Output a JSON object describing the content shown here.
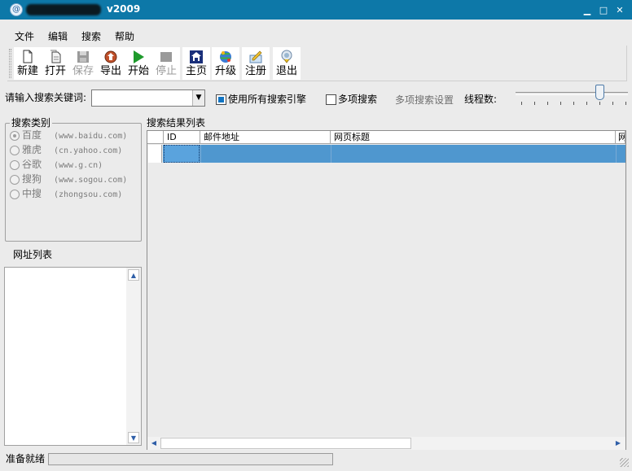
{
  "window": {
    "title_version": "v2009",
    "controls": {
      "minimize": "▁",
      "maximize": "□",
      "close": "✕"
    }
  },
  "menu": [
    "文件",
    "编辑",
    "搜索",
    "帮助"
  ],
  "toolbar": [
    {
      "label": "新建",
      "icon": "new-file-icon",
      "enabled": true
    },
    {
      "label": "打开",
      "icon": "open-file-icon",
      "enabled": true
    },
    {
      "label": "保存",
      "icon": "save-icon",
      "enabled": false
    },
    {
      "label": "导出",
      "icon": "export-icon",
      "enabled": true
    },
    {
      "label": "开始",
      "icon": "play-icon",
      "enabled": true
    },
    {
      "label": "停止",
      "icon": "stop-icon",
      "enabled": false
    },
    {
      "label": "主页",
      "icon": "home-icon",
      "enabled": true
    },
    {
      "label": "升级",
      "icon": "upgrade-icon",
      "enabled": true
    },
    {
      "label": "注册",
      "icon": "register-icon",
      "enabled": true
    },
    {
      "label": "退出",
      "icon": "exit-icon",
      "enabled": true
    }
  ],
  "search": {
    "keyword_label": "请输入搜索关键词:",
    "keyword_value": "",
    "use_all_engines_label": "使用所有搜索引擎",
    "use_all_engines_checked": true,
    "multi_search_label": "多项搜索",
    "multi_search_checked": false,
    "multi_settings_label": "多项搜索设置",
    "threads_label": "线程数:"
  },
  "category": {
    "title": "搜索类别",
    "items": [
      {
        "name": "百度",
        "url": "(www.baidu.com)",
        "selected": true
      },
      {
        "name": "雅虎",
        "url": "(cn.yahoo.com)",
        "selected": false
      },
      {
        "name": "谷歌",
        "url": "(www.g.cn)",
        "selected": false
      },
      {
        "name": "搜狗",
        "url": "(www.sogou.com)",
        "selected": false
      },
      {
        "name": "中搜",
        "url": "(zhongsou.com)",
        "selected": false
      }
    ]
  },
  "url_list": {
    "title": "网址列表"
  },
  "results": {
    "title": "搜索结果列表",
    "columns": [
      "ID",
      "邮件地址",
      "网页标题",
      "网"
    ]
  },
  "status": {
    "text": "准备就绪"
  },
  "colors": {
    "titlebar": "#0d78a8",
    "selection": "#4f97cf",
    "accent": "#1174c2"
  }
}
